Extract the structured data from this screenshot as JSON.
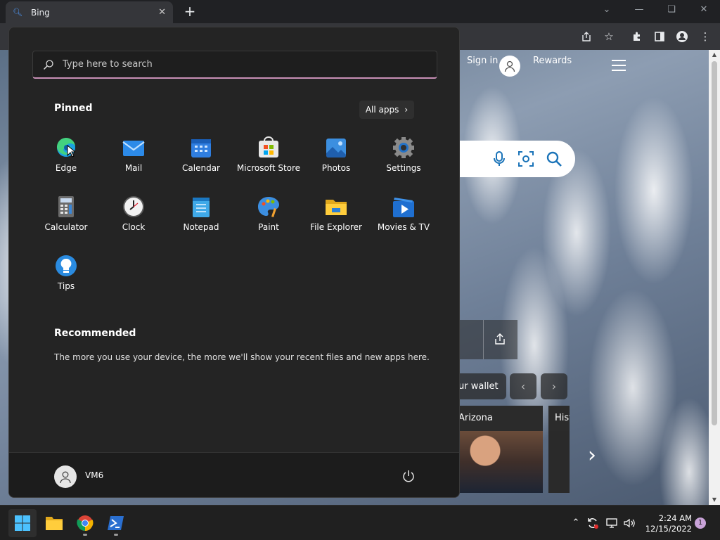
{
  "browser": {
    "tab_title": "Bing",
    "tab_close": "✕",
    "new_tab": "+"
  },
  "bing": {
    "sign_in": "Sign in",
    "rewards": "Rewards",
    "wallet_label": "ur wallet",
    "card1_title": "Arizona",
    "card2_title": "Hist"
  },
  "start_menu": {
    "search_placeholder": "Type here to search",
    "pinned_title": "Pinned",
    "all_apps_label": "All apps",
    "pinned_apps": [
      {
        "label": "Edge",
        "icon": "edge-icon"
      },
      {
        "label": "Mail",
        "icon": "mail-icon"
      },
      {
        "label": "Calendar",
        "icon": "calendar-icon"
      },
      {
        "label": "Microsoft Store",
        "icon": "store-icon"
      },
      {
        "label": "Photos",
        "icon": "photos-icon"
      },
      {
        "label": "Settings",
        "icon": "settings-icon"
      },
      {
        "label": "Calculator",
        "icon": "calculator-icon"
      },
      {
        "label": "Clock",
        "icon": "clock-icon"
      },
      {
        "label": "Notepad",
        "icon": "notepad-icon"
      },
      {
        "label": "Paint",
        "icon": "paint-icon"
      },
      {
        "label": "File Explorer",
        "icon": "folder-icon"
      },
      {
        "label": "Movies & TV",
        "icon": "movies-icon"
      },
      {
        "label": "Tips",
        "icon": "tips-icon"
      }
    ],
    "recommended_title": "Recommended",
    "recommended_text": "The more you use your device, the more we'll show your recent files and new apps here.",
    "user_name": "VM6"
  },
  "taskbar": {
    "time": "2:24 AM",
    "date": "12/15/2022",
    "notification_count": "1"
  },
  "colors": {
    "accent": "#c88fb6",
    "start_bg": "#242424",
    "taskbar_bg": "#202020"
  }
}
